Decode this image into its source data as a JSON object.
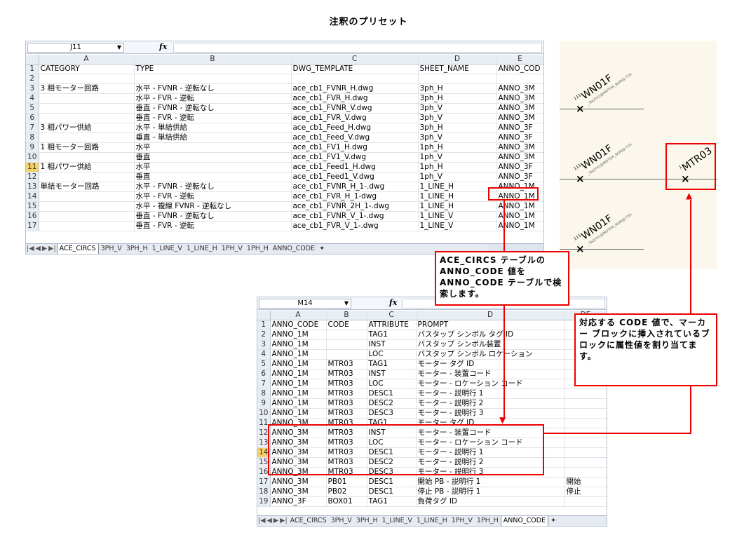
{
  "title": "注釈のプリセット",
  "top_sheet": {
    "cell_ref": "J11",
    "fx": "fx",
    "columns": [
      "",
      "A",
      "B",
      "C",
      "D",
      "E"
    ],
    "rows": [
      {
        "n": "1",
        "a": "CATEGORY",
        "b": "TYPE",
        "c": "DWG_TEMPLATE",
        "d": "SHEET_NAME",
        "e": "ANNO_COD"
      },
      {
        "n": "2",
        "a": "",
        "b": "",
        "c": "",
        "d": "",
        "e": ""
      },
      {
        "n": "3",
        "a": "3 相モーター回路",
        "b": "水平 - FVNR - 逆転なし",
        "c": "ace_cb1_FVNR_H.dwg",
        "d": "3ph_H",
        "e": "ANNO_3M"
      },
      {
        "n": "4",
        "a": "",
        "b": "水平 - FVR - 逆転",
        "c": "ace_cb1_FVR_H.dwg",
        "d": "3ph_H",
        "e": "ANNO_3M"
      },
      {
        "n": "5",
        "a": "",
        "b": "垂直 - FVNR - 逆転なし",
        "c": "ace_cb1_FVNR_V.dwg",
        "d": "3ph_V",
        "e": "ANNO_3M"
      },
      {
        "n": "6",
        "a": "",
        "b": "垂直 - FVR - 逆転",
        "c": "ace_cb1_FVR_V.dwg",
        "d": "3ph_V",
        "e": "ANNO_3M"
      },
      {
        "n": "7",
        "a": "3 相パワー供給",
        "b": "水平 - 単結供給",
        "c": "ace_cb1_Feed_H.dwg",
        "d": "3ph_H",
        "e": "ANNO_3F"
      },
      {
        "n": "8",
        "a": "",
        "b": "垂直 - 単結供給",
        "c": "ace_cb1_Feed_V.dwg",
        "d": "3ph_V",
        "e": "ANNO_3F"
      },
      {
        "n": "9",
        "a": "1 相モーター回路",
        "b": "水平",
        "c": "ace_cb1_FV1_H.dwg",
        "d": "1ph_H",
        "e": "ANNO_3M"
      },
      {
        "n": "10",
        "a": "",
        "b": "垂直",
        "c": "ace_cb1_FV1_V.dwg",
        "d": "1ph_V",
        "e": "ANNO_3M"
      },
      {
        "n": "11",
        "a": "1 相パワー供給",
        "b": "水平",
        "c": "ace_cb1_Feed1_H.dwg",
        "d": "1ph_H",
        "e": "ANNO_3F",
        "sel": true
      },
      {
        "n": "12",
        "a": "",
        "b": "垂直",
        "c": "ace_cb1_Feed1_V.dwg",
        "d": "1ph_V",
        "e": "ANNO_3F"
      },
      {
        "n": "13",
        "a": "単結モーター回路",
        "b": "水平 - FVNR - 逆転なし",
        "c": "ace_cb1_FVNR_H_1-.dwg",
        "d": "1_LINE_H",
        "e": "ANNO_1M"
      },
      {
        "n": "14",
        "a": "",
        "b": "水平 - FVR - 逆転",
        "c": "ace_cb1_FVR_H_1-dwg",
        "d": "1_LINE_H",
        "e": "ANNO_1M"
      },
      {
        "n": "15",
        "a": "",
        "b": "水平 - 複線 FVNR - 逆転なし",
        "c": "ace_cb1_FVNR_2H_1-.dwg",
        "d": "1_LINE_H",
        "e": "ANNO_1M"
      },
      {
        "n": "16",
        "a": "",
        "b": "垂直 - FVNR - 逆転なし",
        "c": "ace_cb1_FVNR_V_1-.dwg",
        "d": "1_LINE_V",
        "e": "ANNO_1M"
      },
      {
        "n": "17",
        "a": "",
        "b": "垂直 - FVR - 逆転",
        "c": "ace_cb1_FVR_V_1-.dwg",
        "d": "1_LINE_V",
        "e": "ANNO_1M"
      }
    ],
    "tabs": [
      "ACE_CIRCS",
      "3PH_V",
      "3PH_H",
      "1_LINE_V",
      "1_LINE_H",
      "1PH_V",
      "1PH_H",
      "ANNO_CODE"
    ],
    "active_tab": 0
  },
  "bottom_sheet": {
    "cell_ref": "M14",
    "fx": "fx",
    "columns": [
      "",
      "A",
      "B",
      "C",
      "D",
      "DE"
    ],
    "rows": [
      {
        "n": "1",
        "a": "ANNO_CODE",
        "b": "CODE",
        "c": "ATTRIBUTE",
        "d": "PROMPT",
        "e": ""
      },
      {
        "n": "2",
        "a": "ANNO_1M",
        "b": "",
        "c": "TAG1",
        "d": "バスタップ シンボル タグ ID",
        "e": ""
      },
      {
        "n": "3",
        "a": "ANNO_1M",
        "b": "",
        "c": "INST",
        "d": "バスタップ シンボル装置",
        "e": ""
      },
      {
        "n": "4",
        "a": "ANNO_1M",
        "b": "",
        "c": "LOC",
        "d": "バスタップ シンボル ロケーション",
        "e": ""
      },
      {
        "n": "5",
        "a": "ANNO_1M",
        "b": "MTR03",
        "c": "TAG1",
        "d": "モーター タグ ID",
        "e": ""
      },
      {
        "n": "6",
        "a": "ANNO_1M",
        "b": "MTR03",
        "c": "INST",
        "d": "モーター - 装置コード",
        "e": ""
      },
      {
        "n": "7",
        "a": "ANNO_1M",
        "b": "MTR03",
        "c": "LOC",
        "d": "モーター - ロケーション コード",
        "e": ""
      },
      {
        "n": "8",
        "a": "ANNO_1M",
        "b": "MTR03",
        "c": "DESC1",
        "d": "モーター - 説明行 1",
        "e": ""
      },
      {
        "n": "9",
        "a": "ANNO_1M",
        "b": "MTR03",
        "c": "DESC2",
        "d": "モーター - 説明行 2",
        "e": ""
      },
      {
        "n": "10",
        "a": "ANNO_1M",
        "b": "MTR03",
        "c": "DESC3",
        "d": "モーター - 説明行 3",
        "e": ""
      },
      {
        "n": "11",
        "a": "ANNO_3M",
        "b": "MTR03",
        "c": "TAG1",
        "d": "モーター タグ ID",
        "e": ""
      },
      {
        "n": "12",
        "a": "ANNO_3M",
        "b": "MTR03",
        "c": "INST",
        "d": "モーター - 装置コード",
        "e": ""
      },
      {
        "n": "13",
        "a": "ANNO_3M",
        "b": "MTR03",
        "c": "LOC",
        "d": "モーター - ロケーション コード",
        "e": ""
      },
      {
        "n": "14",
        "a": "ANNO_3M",
        "b": "MTR03",
        "c": "DESC1",
        "d": "モーター - 説明行 1",
        "e": "",
        "sel": true
      },
      {
        "n": "15",
        "a": "ANNO_3M",
        "b": "MTR03",
        "c": "DESC2",
        "d": "モーター - 説明行 2",
        "e": ""
      },
      {
        "n": "16",
        "a": "ANNO_3M",
        "b": "MTR03",
        "c": "DESC3",
        "d": "モーター - 説明行 3",
        "e": ""
      },
      {
        "n": "17",
        "a": "ANNO_3M",
        "b": "PB01",
        "c": "DESC1",
        "d": "開始 PB - 説明行 1",
        "e": "開始"
      },
      {
        "n": "18",
        "a": "ANNO_3M",
        "b": "PB02",
        "c": "DESC1",
        "d": "停止 PB - 説明行 1",
        "e": "停止"
      },
      {
        "n": "19",
        "a": "ANNO_3F",
        "b": "BOX01",
        "c": "TAG1",
        "d": "負荷タグ ID",
        "e": ""
      }
    ],
    "tabs": [
      "ACE_CIRCS",
      "3PH_V",
      "3PH_H",
      "1_LINE_V",
      "1_LINE_H",
      "1PH_V",
      "1PH_H",
      "ANNO_CODE"
    ],
    "active_tab": 7
  },
  "schematic": {
    "tags": [
      {
        "label": "WN01F",
        "prefix": "111",
        "sub": "_TAGFH1@MOTOR_NUM@-T3A"
      },
      {
        "label": "WN01F",
        "prefix": "111",
        "sub": "_TAGFH1@MOTOR_NUM@-T3A"
      },
      {
        "label": "WN01F",
        "prefix": "111",
        "sub": "_TAGFH1@MOTOR_NUM@-T3A"
      },
      {
        "label": "MTR03",
        "prefix": "1",
        "sub": ""
      }
    ]
  },
  "callouts": {
    "lookup": "ACE_CIRCS テーブルの ANNO_CODE 値を ANNO_CODE テーブルで検索します。",
    "assign": "対応する CODE 値で、マーカー ブロックに挿入されているブロックに属性値を割り当てます。"
  },
  "colors": {
    "callout_red": "#e00000",
    "panel_bg": "#fbf7ec",
    "selected_row_header": "#f7d26b"
  }
}
